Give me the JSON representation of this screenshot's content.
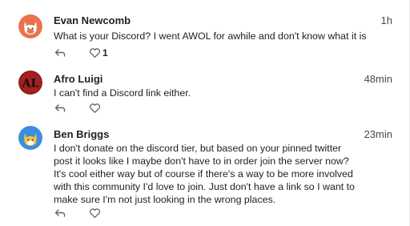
{
  "comments": [
    {
      "author": "Evan Newcomb",
      "time": "1h",
      "text": "What is your Discord? I went AWOL for awhile and don't know what it is",
      "likes": "1",
      "avatar_color": "#e8734c"
    },
    {
      "author": "Afro Luigi",
      "time": "48min",
      "text": "I can't find a Discord link either.",
      "likes": "",
      "avatar_color": "#8b1a1a"
    },
    {
      "author": "Ben Briggs",
      "time": "23min",
      "text_lines": [
        "I don't donate on the discord tier, but based on your pinned twitter",
        "post it looks like I maybe don't have to in order join the server now?",
        "It's cool either way but of course if there's a way to be more involved",
        "with this community I'd love to join. Just don't have a link so I want to",
        "make sure I'm not just looking in the wrong places."
      ],
      "likes": "",
      "avatar_color": "#3a8de0"
    }
  ]
}
